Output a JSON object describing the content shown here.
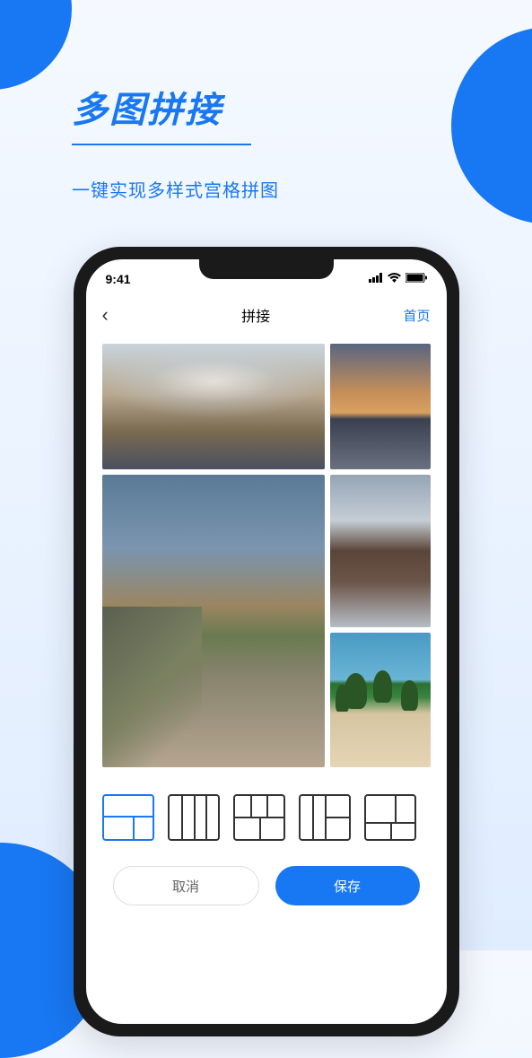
{
  "promo": {
    "title": "多图拼接",
    "subtitle": "一键实现多样式宫格拼图"
  },
  "status_bar": {
    "time": "9:41"
  },
  "nav": {
    "title": "拼接",
    "home_label": "首页"
  },
  "layout_options": [
    {
      "id": "layout-a",
      "active": true
    },
    {
      "id": "layout-b",
      "active": false
    },
    {
      "id": "layout-c",
      "active": false
    },
    {
      "id": "layout-d",
      "active": false
    },
    {
      "id": "layout-e",
      "active": false
    }
  ],
  "actions": {
    "cancel_label": "取消",
    "save_label": "保存"
  }
}
